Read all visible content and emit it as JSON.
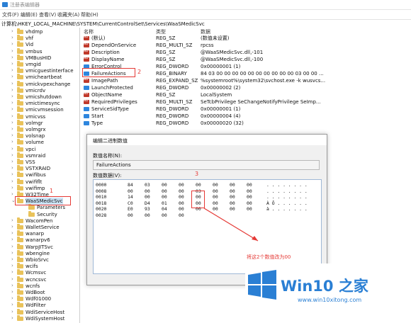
{
  "window": {
    "title": "注册表编辑器"
  },
  "menu": [
    "文件(F)",
    "编辑(E)",
    "查看(V)",
    "收藏夹(A)",
    "帮助(H)"
  ],
  "address": "计算机\\HKEY_LOCAL_MACHINE\\SYSTEM\\CurrentControlSet\\Services\\WaaSMedicSvc",
  "tree": {
    "items": [
      {
        "label": "vhdmp",
        "indent": 0,
        "expanded": false
      },
      {
        "label": "vhf",
        "indent": 0,
        "expanded": false
      },
      {
        "label": "Vid",
        "indent": 0,
        "expanded": false
      },
      {
        "label": "vmbus",
        "indent": 0,
        "expanded": false
      },
      {
        "label": "VMBusHID",
        "indent": 0,
        "expanded": false
      },
      {
        "label": "vmgid",
        "indent": 0,
        "expanded": false
      },
      {
        "label": "vmicguestinterface",
        "indent": 0,
        "expanded": false
      },
      {
        "label": "vmicheartbeat",
        "indent": 0,
        "expanded": false
      },
      {
        "label": "vmickvpexchange",
        "indent": 0,
        "expanded": false
      },
      {
        "label": "vmicrdv",
        "indent": 0,
        "expanded": false
      },
      {
        "label": "vmicshutdown",
        "indent": 0,
        "expanded": false
      },
      {
        "label": "vmictimesync",
        "indent": 0,
        "expanded": false
      },
      {
        "label": "vmicvmsession",
        "indent": 0,
        "expanded": false
      },
      {
        "label": "vmicvss",
        "indent": 0,
        "expanded": false
      },
      {
        "label": "volmgr",
        "indent": 0,
        "expanded": false
      },
      {
        "label": "volmgrx",
        "indent": 0,
        "expanded": false
      },
      {
        "label": "volsnap",
        "indent": 0,
        "expanded": false
      },
      {
        "label": "volume",
        "indent": 0,
        "expanded": false
      },
      {
        "label": "vpci",
        "indent": 0,
        "expanded": false
      },
      {
        "label": "vsmraid",
        "indent": 0,
        "expanded": false
      },
      {
        "label": "VSS",
        "indent": 0,
        "expanded": false
      },
      {
        "label": "VSTXRAID",
        "indent": 0,
        "expanded": false
      },
      {
        "label": "vwifibus",
        "indent": 0,
        "expanded": false
      },
      {
        "label": "vwififlt",
        "indent": 0,
        "expanded": false
      },
      {
        "label": "vwifimp",
        "indent": 0,
        "expanded": false
      },
      {
        "label": "W32Time",
        "indent": 0,
        "expanded": false
      },
      {
        "label": "WaaSMedicSvc",
        "indent": 0,
        "expanded": true,
        "selected": true
      },
      {
        "label": "Parameters",
        "indent": 1,
        "expanded": false
      },
      {
        "label": "Security",
        "indent": 1,
        "expanded": false
      },
      {
        "label": "WacomPen",
        "indent": 0,
        "expanded": false
      },
      {
        "label": "WalletService",
        "indent": 0,
        "expanded": false
      },
      {
        "label": "wanarp",
        "indent": 0,
        "expanded": false
      },
      {
        "label": "wanarpv6",
        "indent": 0,
        "expanded": false
      },
      {
        "label": "WarpJITSvc",
        "indent": 0,
        "expanded": false
      },
      {
        "label": "wbengine",
        "indent": 0,
        "expanded": false
      },
      {
        "label": "WbioSrvc",
        "indent": 0,
        "expanded": false
      },
      {
        "label": "wcifs",
        "indent": 0,
        "expanded": false
      },
      {
        "label": "Wcmsvc",
        "indent": 0,
        "expanded": false
      },
      {
        "label": "wcncsvc",
        "indent": 0,
        "expanded": false
      },
      {
        "label": "wcnfs",
        "indent": 0,
        "expanded": false
      },
      {
        "label": "WdBoot",
        "indent": 0,
        "expanded": false
      },
      {
        "label": "Wdf01000",
        "indent": 0,
        "expanded": false
      },
      {
        "label": "WdFilter",
        "indent": 0,
        "expanded": false
      },
      {
        "label": "WdiServiceHost",
        "indent": 0,
        "expanded": false
      },
      {
        "label": "WdiSystemHost",
        "indent": 0,
        "expanded": false
      }
    ]
  },
  "list": {
    "headers": {
      "name": "名称",
      "type": "类型",
      "data": "数据"
    },
    "rows": [
      {
        "name": "(默认)",
        "type": "REG_SZ",
        "data": "(数值未设置)",
        "icon": "string-value-icon"
      },
      {
        "name": "DependOnService",
        "type": "REG_MULTI_SZ",
        "data": "rpcss",
        "icon": "string-value-icon"
      },
      {
        "name": "Description",
        "type": "REG_SZ",
        "data": "@WaaSMedicSvc.dll,-101",
        "icon": "string-value-icon"
      },
      {
        "name": "DisplayName",
        "type": "REG_SZ",
        "data": "@WaaSMedicSvc.dll,-100",
        "icon": "string-value-icon"
      },
      {
        "name": "ErrorControl",
        "type": "REG_DWORD",
        "data": "0x00000001 (1)",
        "icon": "binary-value-icon"
      },
      {
        "name": "FailureActions",
        "type": "REG_BINARY",
        "data": "84 03 00 00 00 00 00 00 00 00 00 00 03 00 00 ...",
        "icon": "binary-value-icon"
      },
      {
        "name": "ImagePath",
        "type": "REG_EXPAND_SZ",
        "data": "%systemroot%\\system32\\svchost.exe -k wusvcs...",
        "icon": "string-value-icon"
      },
      {
        "name": "LaunchProtected",
        "type": "REG_DWORD",
        "data": "0x00000002 (2)",
        "icon": "binary-value-icon"
      },
      {
        "name": "ObjectName",
        "type": "REG_SZ",
        "data": "LocalSystem",
        "icon": "string-value-icon"
      },
      {
        "name": "RequiredPrivileges",
        "type": "REG_MULTI_SZ",
        "data": "SeTcbPrivilege SeChangeNotifyPrivilege SeImp...",
        "icon": "string-value-icon"
      },
      {
        "name": "ServiceSidType",
        "type": "REG_DWORD",
        "data": "0x00000001 (1)",
        "icon": "binary-value-icon"
      },
      {
        "name": "Start",
        "type": "REG_DWORD",
        "data": "0x00000004 (4)",
        "icon": "binary-value-icon"
      },
      {
        "name": "Type",
        "type": "REG_DWORD",
        "data": "0x00000020 (32)",
        "icon": "binary-value-icon"
      }
    ]
  },
  "dialog": {
    "title": "编辑二进制数值",
    "name_label": "数值名称(N):",
    "name_value": "FailureActions",
    "data_label": "数值数据(V):",
    "hex_rows": [
      {
        "offset": "0000",
        "bytes": [
          "84",
          "03",
          "00",
          "00",
          "00",
          "00",
          "00",
          "00"
        ],
        "ascii": ". . . . . . . ."
      },
      {
        "offset": "0008",
        "bytes": [
          "00",
          "00",
          "00",
          "00",
          "03",
          "00",
          "00",
          "00"
        ],
        "ascii": ". . . . . . . ."
      },
      {
        "offset": "0010",
        "bytes": [
          "14",
          "00",
          "00",
          "00",
          "00",
          "00",
          "00",
          "00"
        ],
        "ascii": ". . . . . . . ."
      },
      {
        "offset": "0018",
        "bytes": [
          "C0",
          "D4",
          "01",
          "00",
          "00",
          "00",
          "00",
          "00"
        ],
        "ascii": "À Ô . . . . . ."
      },
      {
        "offset": "0020",
        "bytes": [
          "E0",
          "93",
          "04",
          "00",
          "00",
          "00",
          "00",
          "00"
        ],
        "ascii": "à . . . . . . ."
      },
      {
        "offset": "0028",
        "bytes": [
          "00",
          "00",
          "00",
          "00"
        ],
        "ascii": ""
      }
    ]
  },
  "annotations": {
    "step1": "1",
    "step2": "2",
    "step3": "3",
    "note": "将这2个数值改为00"
  },
  "watermark": {
    "brand": "Win10 之家",
    "url": "www.win10xitong.com",
    "color": "#2a7fd4"
  }
}
